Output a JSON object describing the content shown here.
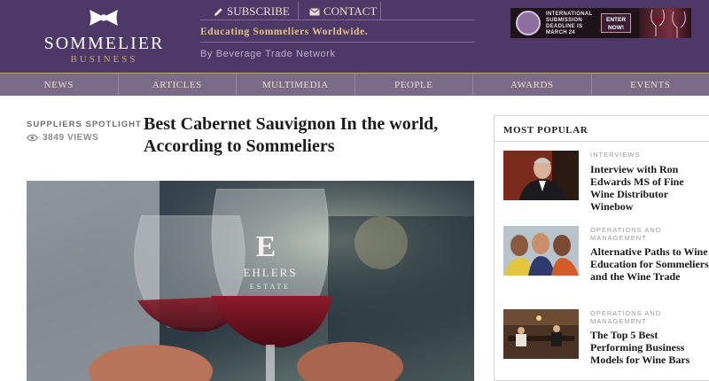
{
  "brand": {
    "name": "SOMMELIER",
    "sub": "BUSINESS"
  },
  "toplinks": {
    "subscribe": "SUBSCRIBE",
    "contact": "CONTACT"
  },
  "tagline": "Educating Sommeliers Worldwide.",
  "byline": "By Beverage Trade Network",
  "banner": {
    "line1": "INTERNATIONAL",
    "line2": "SUBMISSION",
    "line3": "DEADLINE IS",
    "line4": "MARCH 24",
    "cta": "ENTER NOW!"
  },
  "nav": [
    "NEWS",
    "ARTICLES",
    "MULTIMEDIA",
    "PEOPLE",
    "AWARDS",
    "EVENTS"
  ],
  "article": {
    "category": "SUPPLIERS SPOTLIGHT",
    "views": "3849 VIEWS",
    "title": "Best Cabernet Sauvignon In the world, According to Sommeliers",
    "image_glass_text_1": "E",
    "image_glass_text_2": "EHLERS",
    "image_glass_text_3": "ESTATE"
  },
  "sidebar": {
    "title": "MOST POPULAR",
    "items": [
      {
        "category": "INTERVIEWS",
        "title": "Interview with Ron Edwards MS of Fine Wine Distributor Winebow"
      },
      {
        "category": "OPERATIONS AND MANAGEMENT",
        "title": "Alternative Paths to Wine Education for Sommeliers and the Wine Trade"
      },
      {
        "category": "OPERATIONS AND MANAGEMENT",
        "title": "The Top 5 Best Performing Business Models for Wine Bars"
      }
    ]
  },
  "colors": {
    "header_bg": "#4d3867",
    "nav_bg": "#7a6b88",
    "gold": "#c9a866"
  }
}
